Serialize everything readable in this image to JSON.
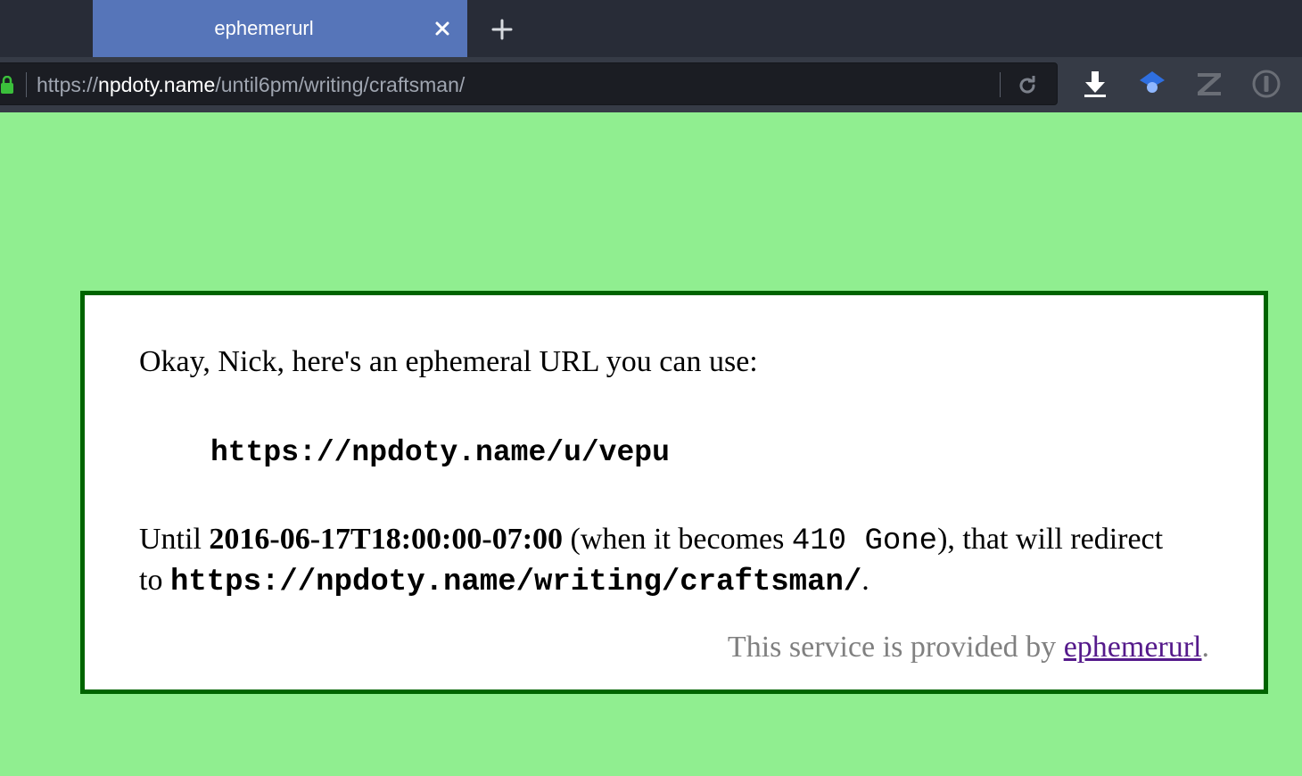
{
  "tabs": [
    {
      "title": "ephemerurl",
      "active": true
    }
  ],
  "toolbar": {
    "url_scheme": "https://",
    "url_host": "npdoty.name",
    "url_path": "/until6pm/writing/craftsman/",
    "icons": [
      "lock-icon",
      "reload-icon",
      "download-icon",
      "privacy-badger-icon",
      "zotero-icon",
      "onepassword-icon"
    ]
  },
  "content": {
    "intro": "Okay, Nick, here's an ephemeral URL you can use:",
    "short_url": "https://npdoty.name/u/vepu",
    "until_prefix": "Until ",
    "expiry": "2016-06-17T18:00:00-07:00",
    "when_prefix": " (when it becomes ",
    "status_code": "410 Gone",
    "when_suffix": "), that will redirect to ",
    "target_url": "https://npdoty.name/writing/craftsman/",
    "target_suffix": ".",
    "credit_text": "This service is provided by ",
    "credit_link": "ephemerurl",
    "credit_suffix": "."
  },
  "colors": {
    "page_background": "#90ee90",
    "panel_border": "#006400",
    "tab_active": "#5675b9",
    "link_visited": "#551a8b"
  }
}
